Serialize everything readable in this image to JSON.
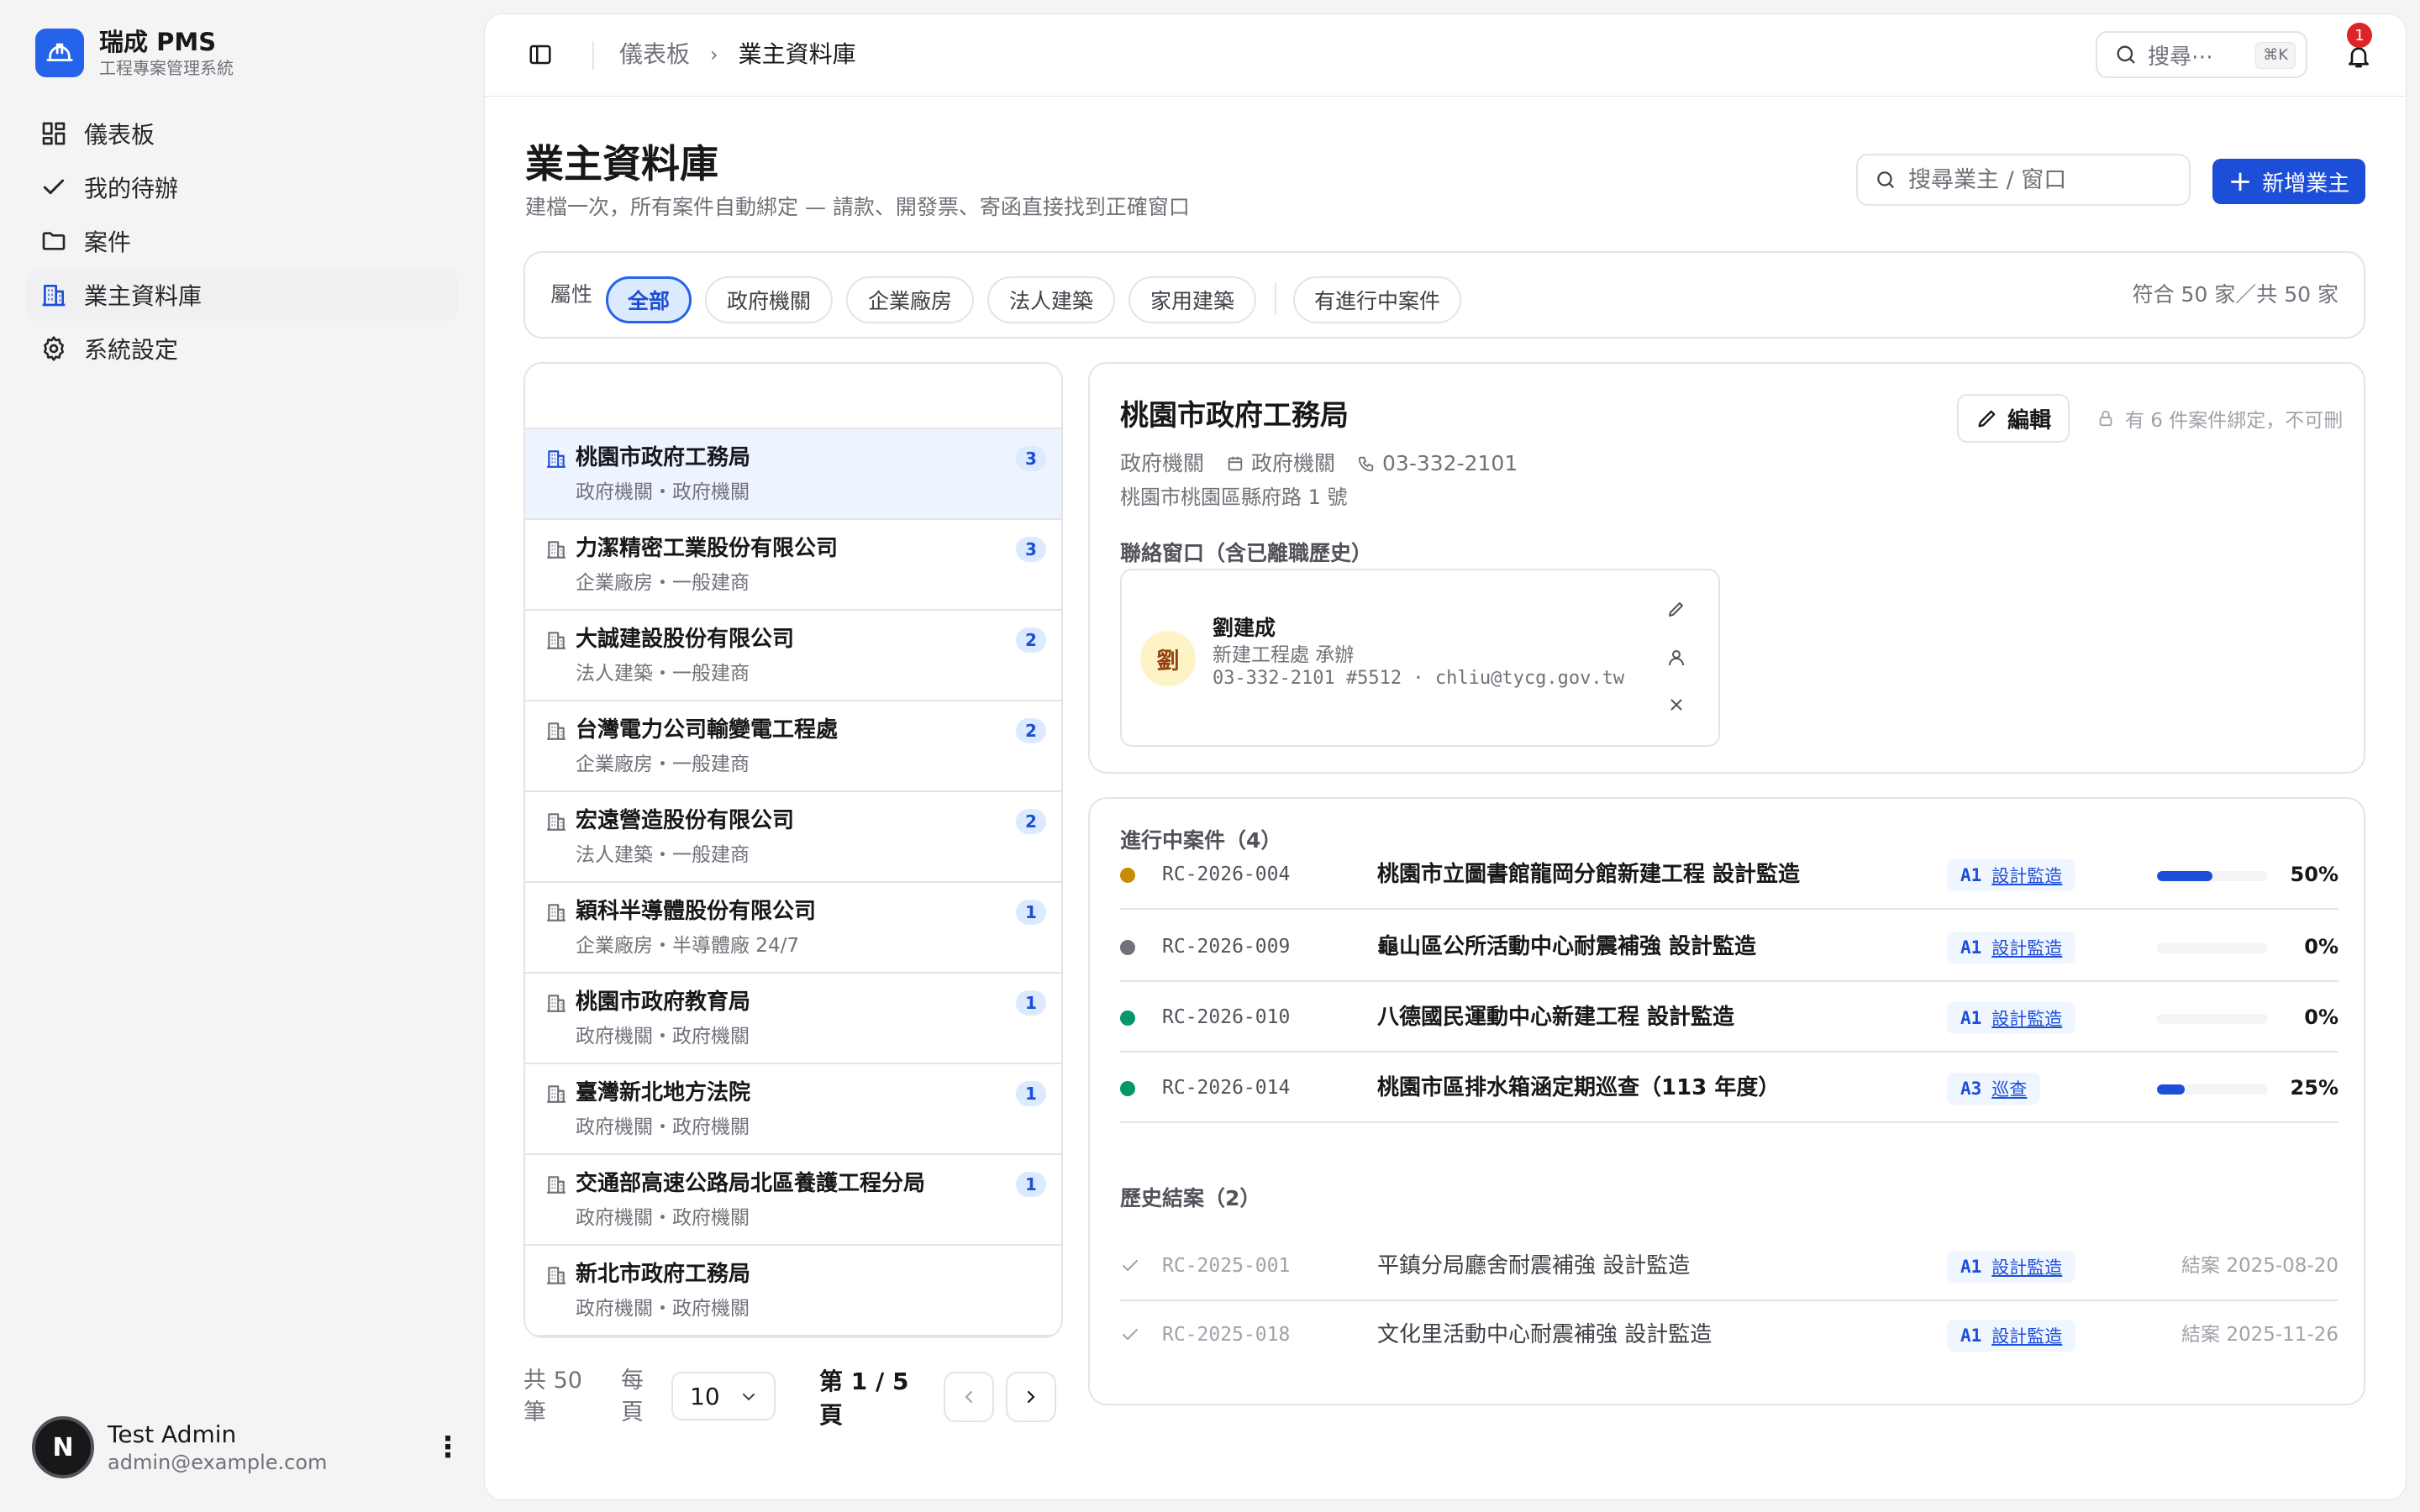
{
  "brand": {
    "name": "瑞成 PMS",
    "subtitle": "工程專案管理系統"
  },
  "nav": [
    {
      "label": "儀表板",
      "icon": "dashboard-icon"
    },
    {
      "label": "我的待辦",
      "icon": "check-icon"
    },
    {
      "label": "案件",
      "icon": "folder-icon"
    },
    {
      "label": "業主資料庫",
      "icon": "building-icon",
      "active": true
    },
    {
      "label": "系統設定",
      "icon": "gear-icon"
    }
  ],
  "user": {
    "initial": "N",
    "name": "Test Admin",
    "email": "admin@example.com"
  },
  "topbar": {
    "breadcrumb": [
      "儀表板",
      "業主資料庫"
    ],
    "search_placeholder": "搜尋⋯",
    "shortcut": "⌘K",
    "notifications": "1"
  },
  "page": {
    "title": "業主資料庫",
    "subtitle": "建檔一次，所有案件自動綁定 — 請款、開發票、寄函直接找到正確窗口",
    "search_placeholder": "搜尋業主 / 窗口",
    "add_label": "新增業主"
  },
  "filters": {
    "label": "屬性",
    "chips": [
      "全部",
      "政府機關",
      "企業廠房",
      "法人建築",
      "家用建築",
      "有進行中案件"
    ],
    "active": "全部",
    "count": "符合 50 家／共 50 家"
  },
  "owners": [
    {
      "name": "桃園市政府工務局",
      "sub": "政府機關・政府機關",
      "count": "3"
    },
    {
      "name": "力潔精密工業股份有限公司",
      "sub": "企業廠房・一般建商",
      "count": "3"
    },
    {
      "name": "大誠建設股份有限公司",
      "sub": "法人建築・一般建商",
      "count": "2"
    },
    {
      "name": "台灣電力公司輸變電工程處",
      "sub": "企業廠房・一般建商",
      "count": "2"
    },
    {
      "name": "宏遠營造股份有限公司",
      "sub": "法人建築・一般建商",
      "count": "2"
    },
    {
      "name": "穎科半導體股份有限公司",
      "sub": "企業廠房・半導體廠 24/7",
      "count": "1"
    },
    {
      "name": "桃園市政府教育局",
      "sub": "政府機關・政府機關",
      "count": "1"
    },
    {
      "name": "臺灣新北地方法院",
      "sub": "政府機關・政府機關",
      "count": "1"
    },
    {
      "name": "交通部高速公路局北區養護工程分局",
      "sub": "政府機關・政府機關",
      "count": "1"
    },
    {
      "name": "新北市政府工務局",
      "sub": "政府機關・政府機關",
      "count": ""
    }
  ],
  "pager": {
    "total_a": "共 50",
    "total_b": "筆",
    "per_a": "每",
    "per_b": "頁",
    "per_value": "10",
    "page_a": "第 1 / 5",
    "page_b": "頁"
  },
  "detail": {
    "name": "桃園市政府工務局",
    "type": "政府機關",
    "category": "政府機關",
    "phone": "03-332-2101",
    "address": "桃園市桃園區縣府路 1 號",
    "edit_label": "編輯",
    "lock_note": "有 6 件案件綁定，不可刪",
    "contacts_title": "聯絡窗口（含已離職歷史）",
    "contact": {
      "initial": "劉",
      "name": "劉建成",
      "role": "新建工程處 承辦",
      "info": "03-332-2101 #5512 · chliu@tycg.gov.tw"
    }
  },
  "cases": {
    "active_title": "進行中案件（4）",
    "active": [
      {
        "code": "RC-2026-004",
        "name": "桃園市立圖書館龍岡分館新建工程 設計監造",
        "tag_code": "A1",
        "tag_label": "設計監造",
        "progress": 50,
        "pct": "50%",
        "dot": "#ca8a04"
      },
      {
        "code": "RC-2026-009",
        "name": "龜山區公所活動中心耐震補強 設計監造",
        "tag_code": "A1",
        "tag_label": "設計監造",
        "progress": 0,
        "pct": "0%",
        "dot": "#71717a"
      },
      {
        "code": "RC-2026-010",
        "name": "八德國民運動中心新建工程 設計監造",
        "tag_code": "A1",
        "tag_label": "設計監造",
        "progress": 0,
        "pct": "0%",
        "dot": "#059669"
      },
      {
        "code": "RC-2026-014",
        "name": "桃園市區排水箱涵定期巡查（113 年度）",
        "tag_code": "A3",
        "tag_label": "巡查",
        "progress": 25,
        "pct": "25%",
        "dot": "#059669"
      }
    ],
    "history_title": "歷史結案（2）",
    "history": [
      {
        "code": "RC-2025-001",
        "name": "平鎮分局廳舍耐震補強 設計監造",
        "tag_code": "A1",
        "tag_label": "設計監造",
        "closed": "結案 2025-08-20"
      },
      {
        "code": "RC-2025-018",
        "name": "文化里活動中心耐震補強 設計監造",
        "tag_code": "A1",
        "tag_label": "設計監造",
        "closed": "結案 2025-11-26"
      }
    ]
  }
}
